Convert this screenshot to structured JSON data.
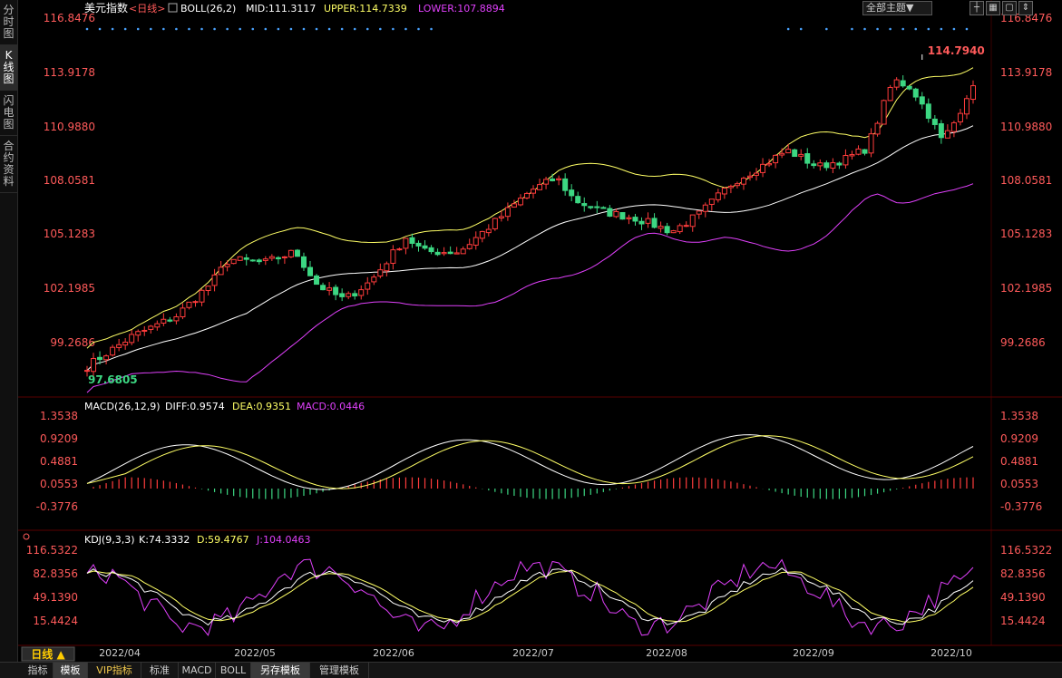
{
  "side_tabs": [
    "分时图",
    "K线图",
    "闪电图",
    "合约资料"
  ],
  "header": {
    "title": "美元指数",
    "period": "<日线>",
    "indicator": "BOLL(26,2)",
    "mid": "MID:111.3117",
    "upper": "UPPER:114.7339",
    "lower": "LOWER:107.8894",
    "theme_select": "全部主题▼"
  },
  "price_axis": [
    "116.8476",
    "113.9178",
    "110.9880",
    "108.0581",
    "105.1283",
    "102.1985",
    "99.2686"
  ],
  "annotations": {
    "high": "114.7940",
    "low": "97.6805"
  },
  "macd": {
    "title": "MACD(26,12,9)",
    "diff": "DIFF:0.9574",
    "dea": "DEA:0.9351",
    "macd": "MACD:0.0446",
    "axis": [
      "1.3538",
      "0.9209",
      "0.4881",
      "0.0553",
      "-0.3776"
    ]
  },
  "kdj": {
    "title": "KDJ(9,3,3)",
    "k": "K:74.3332",
    "d": "D:59.4767",
    "j": "J:104.0463",
    "axis": [
      "116.5322",
      "82.8356",
      "49.1390",
      "15.4424"
    ]
  },
  "period_button": "日线 ▲",
  "date_labels": [
    "2022/04",
    "2022/05",
    "2022/06",
    "2022/07",
    "2022/08",
    "2022/09",
    "2022/10"
  ],
  "bottom_tabs": [
    "指标",
    "模板",
    "VIP指标",
    "标准",
    "MACD",
    "BOLL",
    "另存模板",
    "管理模板"
  ],
  "colors": {
    "up": "#ff3c3c",
    "down": "#3cd782",
    "mid": "#ffffff",
    "upper": "#ffff66",
    "lower": "#e040fb",
    "axis_text": "#ff5a5a",
    "title": "#ffffff"
  }
}
